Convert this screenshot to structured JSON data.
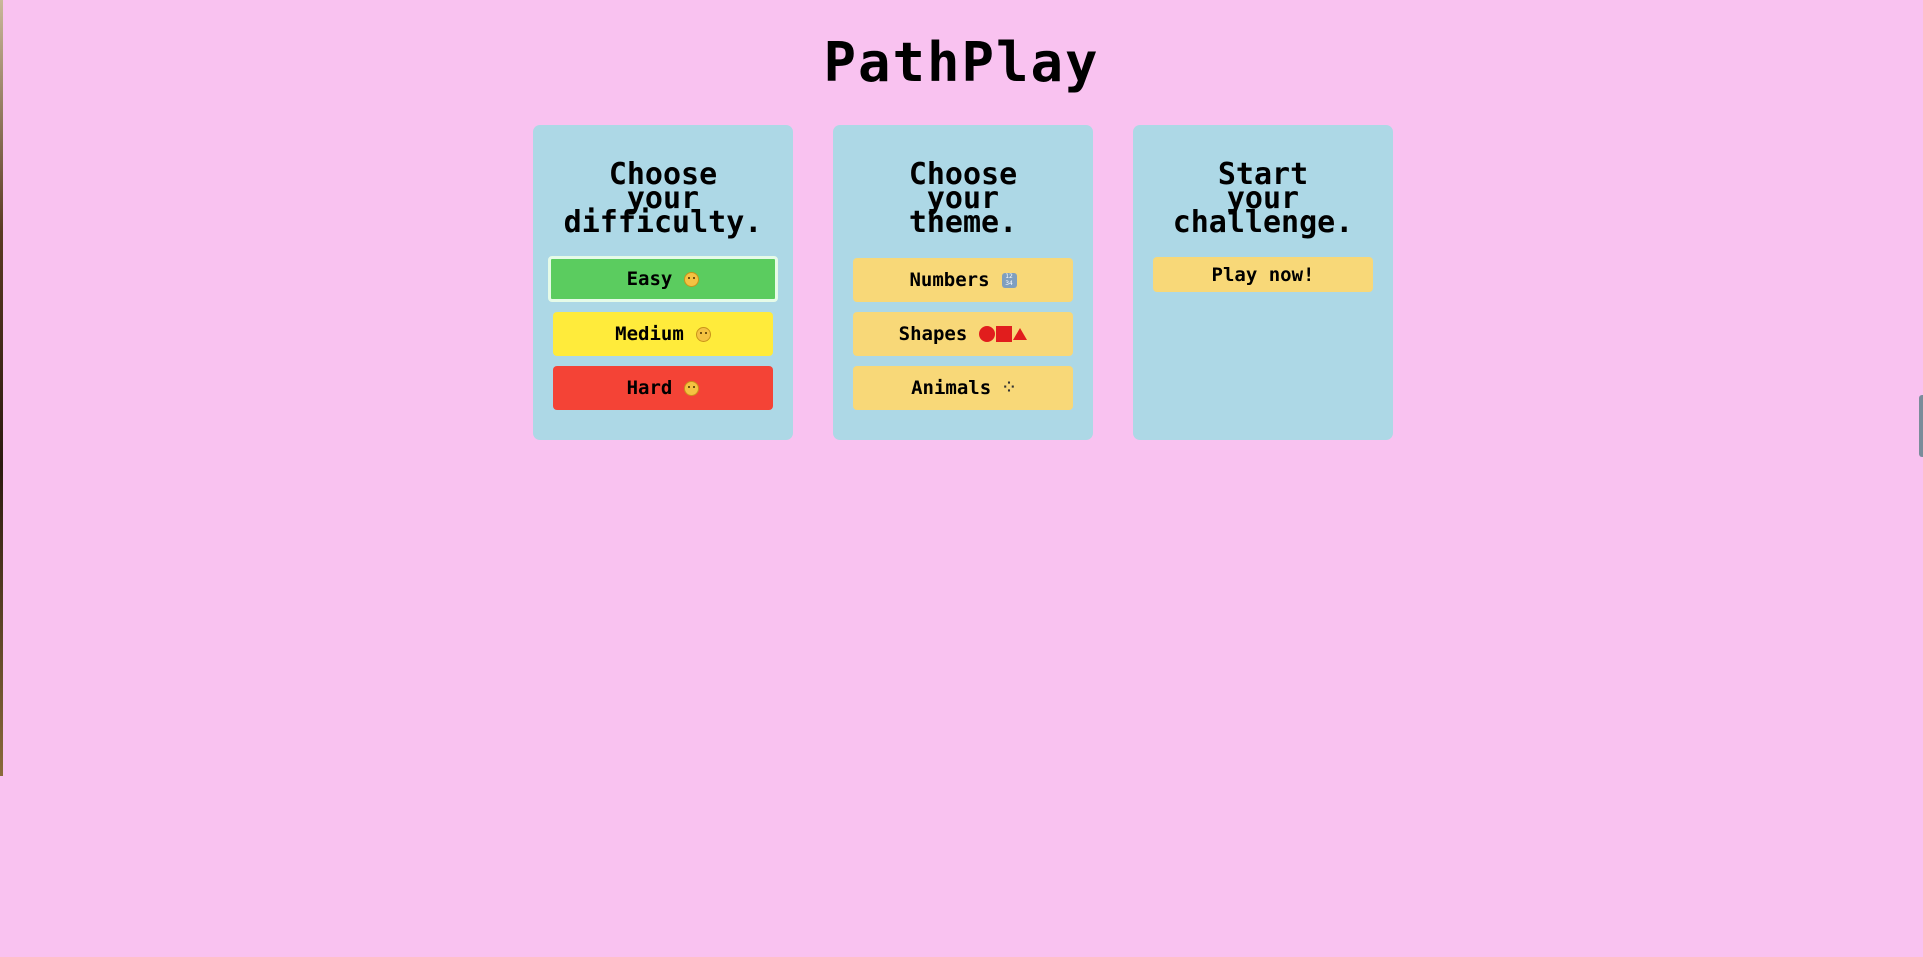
{
  "app": {
    "title": "PathPlay"
  },
  "difficulty": {
    "heading": "Choose\nyour\ndifficulty.",
    "options": [
      {
        "label": "Easy",
        "icon": "slightly-smiling-face-icon",
        "color": "#5bcc5f",
        "selected": true
      },
      {
        "label": "Medium",
        "icon": "neutral-face-icon",
        "color": "#ffeb3b",
        "selected": false
      },
      {
        "label": "Hard",
        "icon": "angry-face-icon",
        "color": "#f44336",
        "selected": false
      }
    ]
  },
  "theme": {
    "heading": "Choose\nyour\ntheme.",
    "options": [
      {
        "label": "Numbers",
        "icon": "input-numbers-icon"
      },
      {
        "label": "Shapes",
        "icon": "shapes-circle-square-triangle-icon"
      },
      {
        "label": "Animals",
        "icon": "paw-prints-icon"
      }
    ]
  },
  "start": {
    "heading": "Start\nyour\nchallenge.",
    "play_label": "Play now!"
  },
  "colors": {
    "background": "#f9c2f0",
    "panel": "#add8e6",
    "theme_button": "#f8d878"
  }
}
